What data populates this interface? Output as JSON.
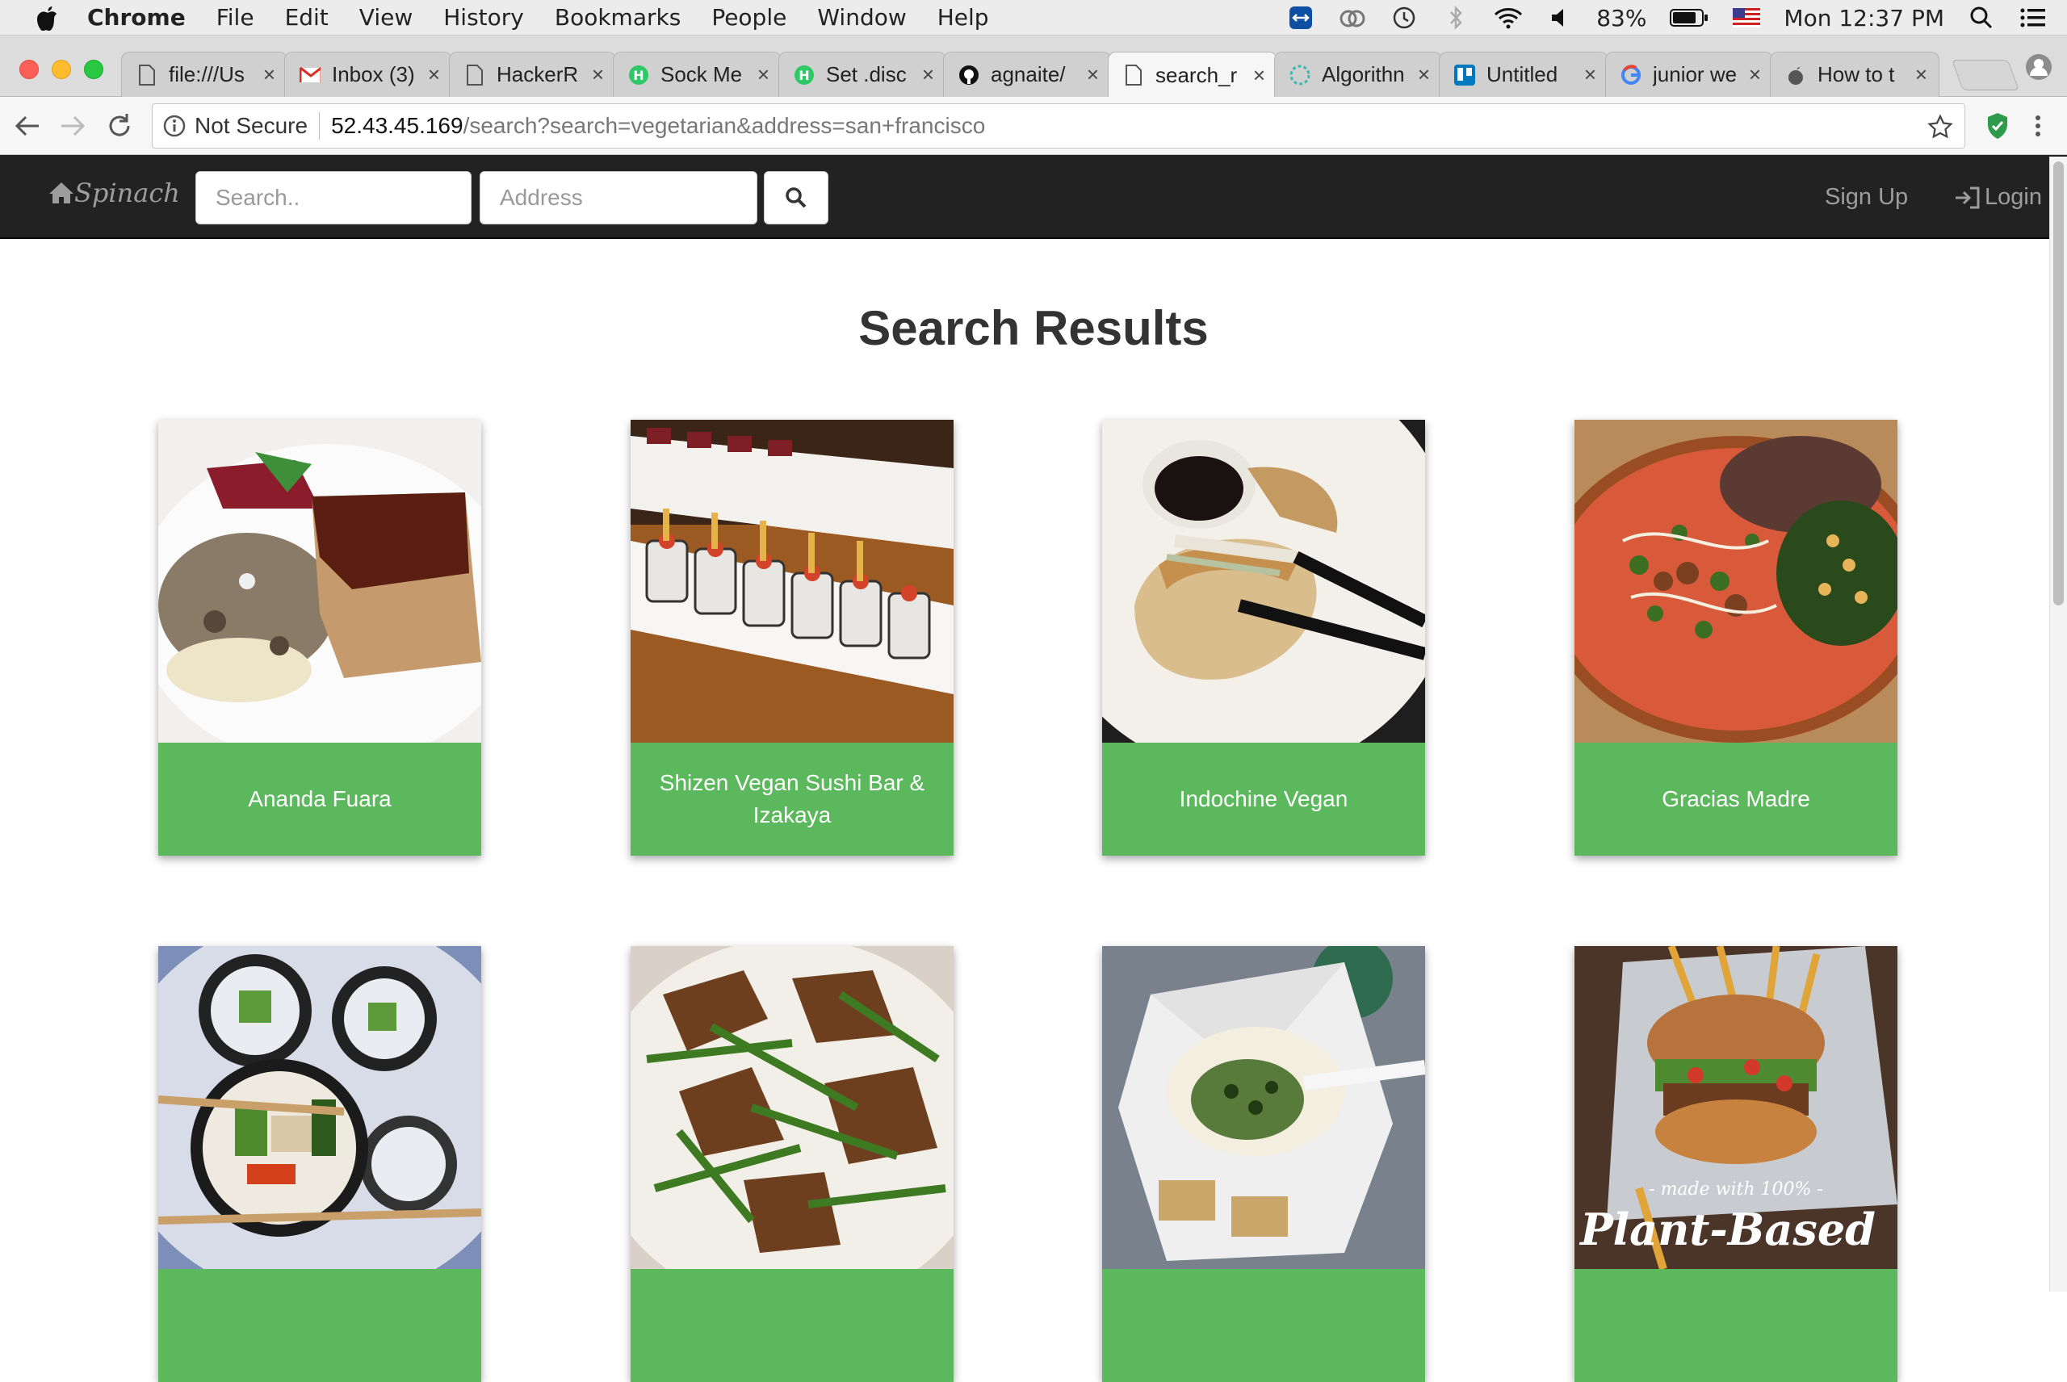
{
  "menubar": {
    "app": "Chrome",
    "items": [
      "File",
      "Edit",
      "View",
      "History",
      "Bookmarks",
      "People",
      "Window",
      "Help"
    ],
    "battery": "83%",
    "clock": "Mon 12:37 PM"
  },
  "tabs": [
    {
      "title": "file:///Us",
      "icon": "document-icon"
    },
    {
      "title": "Inbox (3)",
      "icon": "gmail-icon"
    },
    {
      "title": "HackerR",
      "icon": "document-icon"
    },
    {
      "title": "Sock Me",
      "icon": "hackerrank-icon"
    },
    {
      "title": "Set .disc",
      "icon": "hackerrank-icon"
    },
    {
      "title": "agnaite/",
      "icon": "github-icon"
    },
    {
      "title": "search_r",
      "icon": "document-icon"
    },
    {
      "title": "Algorithn",
      "icon": "algorithm-icon"
    },
    {
      "title": "Untitled",
      "icon": "trello-icon"
    },
    {
      "title": "junior we",
      "icon": "google-icon"
    },
    {
      "title": "How to t",
      "icon": "apple-icon"
    }
  ],
  "address": {
    "security": "Not Secure",
    "host": "52.43.45.169",
    "path": "/search?search=vegetarian&address=san+francisco"
  },
  "site": {
    "brand": "Spinach",
    "search_placeholder": "Search..",
    "address_placeholder": "Address",
    "signup": "Sign Up",
    "login": "Login"
  },
  "page_title": "Search Results",
  "results": [
    {
      "name": "Ananda Fuara"
    },
    {
      "name": "Shizen Vegan Sushi Bar & Izakaya"
    },
    {
      "name": "Indochine Vegan"
    },
    {
      "name": "Gracias Madre"
    },
    {
      "name": ""
    },
    {
      "name": ""
    },
    {
      "name": ""
    },
    {
      "name": ""
    }
  ],
  "photo_text": "- made with 100% -\nPlant-Based",
  "colors": {
    "card": "#5cb85c",
    "navbar": "#222222"
  }
}
